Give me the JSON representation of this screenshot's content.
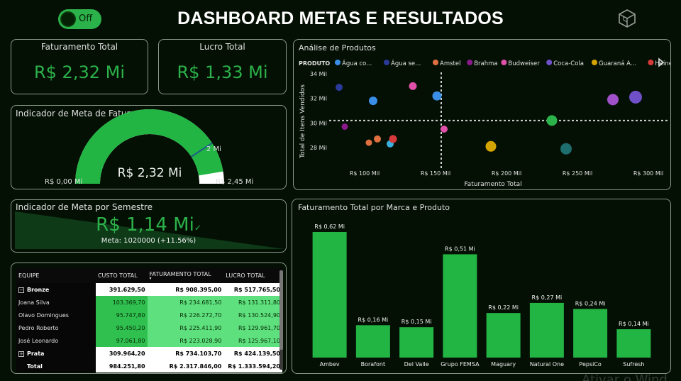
{
  "header": {
    "title": "DASHBOARD METAS E RESULTADOS",
    "toggle_label": "Off"
  },
  "kpis": {
    "faturamento": {
      "title": "Faturamento Total",
      "value": "R$ 2,32 Mi"
    },
    "lucro": {
      "title": "Lucro Total",
      "value": "R$ 1,33 Mi"
    }
  },
  "gauge": {
    "title": "Indicador de Meta de Faturamento",
    "value_label": "R$ 2,32 Mi",
    "min_label": "R$ 0,00 Mi",
    "max_label": "R$ 2,45 Mi",
    "target_label": "2 Mi",
    "value": 2.32,
    "min": 0,
    "max": 2.45,
    "target": 2
  },
  "semester": {
    "title": "Indicador de Meta por Semestre",
    "value": "R$ 1,14 Mi",
    "meta": "Meta: 1020000 (+11.56%)"
  },
  "table": {
    "headers": [
      "EQUIPE",
      "CUSTO TOTAL",
      "FATURAMENTO TOTAL",
      "LUCRO TOTAL"
    ],
    "groups": [
      {
        "name": "Bronze",
        "custo": "391.629,50",
        "fat": "R$ 908.395,00",
        "lucro": "R$ 517.765,50",
        "rows": [
          {
            "name": "Joana Silva",
            "custo": "103.369,70",
            "fat": "R$ 234.681,50",
            "lucro": "R$ 131.311,80"
          },
          {
            "name": "Olavo Domingues",
            "custo": "95.747,80",
            "fat": "R$ 226.272,70",
            "lucro": "R$ 130.524,90"
          },
          {
            "name": "Pedro Roberto",
            "custo": "95.450,20",
            "fat": "R$ 225.411,90",
            "lucro": "R$ 129.961,70"
          },
          {
            "name": "José Leonardo",
            "custo": "97.061,80",
            "fat": "R$ 223.028,90",
            "lucro": "R$ 125.967,10"
          }
        ]
      },
      {
        "name": "Prata",
        "custo": "309.964,20",
        "fat": "R$ 734.103,70",
        "lucro": "R$ 424.139,50",
        "rows": []
      }
    ],
    "total": {
      "name": "Total",
      "custo": "984.251,80",
      "fat": "R$ 2.317.846,00",
      "lucro": "R$ 1.333.594,20"
    }
  },
  "chart_data": [
    {
      "type": "scatter",
      "title": "Análise de Produtos",
      "legend_title": "PRODUTO",
      "legend_position": "top",
      "legend": [
        {
          "name": "Água co...",
          "color": "#3a8ee8"
        },
        {
          "name": "Água se...",
          "color": "#2a3a9a"
        },
        {
          "name": "Amstel",
          "color": "#e07040"
        },
        {
          "name": "Brahma",
          "color": "#8a1a8a"
        },
        {
          "name": "Budweiser",
          "color": "#e050a8"
        },
        {
          "name": "Coca-Cola",
          "color": "#7050c8"
        },
        {
          "name": "Guaraná A...",
          "color": "#d4a400"
        },
        {
          "name": "Heineken",
          "color": "#d83a3a"
        }
      ],
      "xlabel": "Faturamento Total",
      "ylabel": "Total de Itens Vendidos",
      "xlim": [
        75,
        300
      ],
      "ylim": [
        26.5,
        34
      ],
      "x_ticks": [
        100,
        150,
        200,
        250,
        300
      ],
      "x_tick_labels": [
        "R$ 100 Mil",
        "R$ 150 Mil",
        "R$ 200 Mil",
        "R$ 250 Mil",
        "R$ 300 Mil"
      ],
      "y_ticks": [
        28,
        30,
        32,
        34
      ],
      "y_tick_labels": [
        "28 Mil",
        "30 Mil",
        "32 Mil",
        "34 Mil"
      ],
      "ref_x": 154,
      "ref_y": 30.2,
      "points": [
        {
          "x": 82,
          "y": 32.9,
          "size": 5,
          "color": "#2a3a9a"
        },
        {
          "x": 106,
          "y": 31.8,
          "size": 6,
          "color": "#3a8ee8"
        },
        {
          "x": 134,
          "y": 33.0,
          "size": 5.5,
          "color": "#e050a8"
        },
        {
          "x": 151,
          "y": 32.2,
          "size": 6.5,
          "color": "#3a8ee8"
        },
        {
          "x": 86,
          "y": 29.7,
          "size": 4.5,
          "color": "#8a1a8a"
        },
        {
          "x": 103,
          "y": 28.4,
          "size": 4.5,
          "color": "#e07040"
        },
        {
          "x": 109,
          "y": 28.7,
          "size": 5,
          "color": "#e07040"
        },
        {
          "x": 118,
          "y": 28.3,
          "size": 5,
          "color": "#3ab0e0"
        },
        {
          "x": 120,
          "y": 28.7,
          "size": 5.5,
          "color": "#d83a3a"
        },
        {
          "x": 156,
          "y": 29.5,
          "size": 5,
          "color": "#e050a8"
        },
        {
          "x": 189,
          "y": 28.1,
          "size": 7.5,
          "color": "#d4a400"
        },
        {
          "x": 232,
          "y": 30.2,
          "size": 7.5,
          "color": "#2cb24a"
        },
        {
          "x": 242,
          "y": 27.9,
          "size": 8,
          "color": "#1e6e6e"
        },
        {
          "x": 275,
          "y": 31.9,
          "size": 8,
          "color": "#a050c8"
        },
        {
          "x": 291,
          "y": 32.1,
          "size": 9,
          "color": "#7050c8"
        }
      ]
    },
    {
      "type": "bar",
      "title": "Faturamento Total por Marca e Produto",
      "categories": [
        "Ambev",
        "Borafont",
        "Del Valle",
        "Grupo FEMSA",
        "Maguary",
        "Natural One",
        "PepsiCo",
        "Sufresh"
      ],
      "values": [
        0.62,
        0.16,
        0.15,
        0.51,
        0.22,
        0.27,
        0.24,
        0.14
      ],
      "value_labels": [
        "R$ 0,62 Mi",
        "R$ 0,16 Mi",
        "R$ 0,15 Mi",
        "R$ 0,51 Mi",
        "R$ 0,22 Mi",
        "R$ 0,27 Mi",
        "R$ 0,24 Mi",
        "R$ 0,14 Mi"
      ],
      "ylim": [
        0,
        0.62
      ],
      "bar_color": "#22b544"
    }
  ],
  "watermark": "Ativar o Wind"
}
